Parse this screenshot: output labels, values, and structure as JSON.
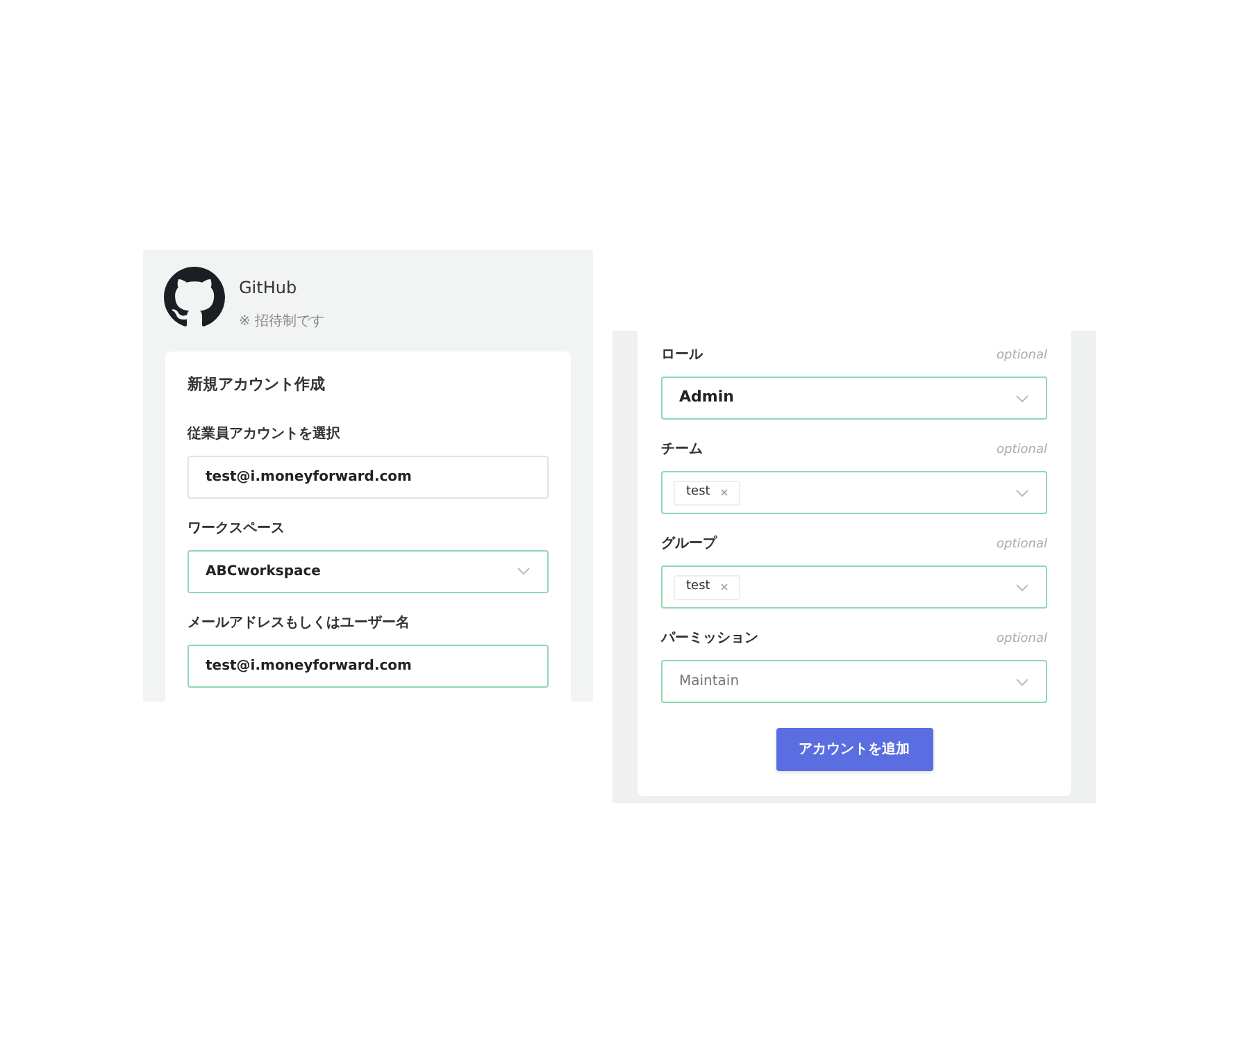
{
  "left_panel": {
    "app": {
      "name": "GitHub",
      "note": "※ 招待制です"
    },
    "card_title": "新規アカウント作成",
    "fields": [
      {
        "label": "従業員アカウントを選択",
        "kind": "input",
        "value": "test@i.moneyforward.com",
        "highlighted": false
      },
      {
        "label": "ワークスペース",
        "kind": "select",
        "value": "ABCworkspace",
        "highlighted": true
      },
      {
        "label": "メールアドレスもしくはユーザー名",
        "kind": "input",
        "value": "test@i.moneyforward.com",
        "highlighted": true
      }
    ]
  },
  "right_panel": {
    "fields": [
      {
        "label": "ロール",
        "hint": "optional",
        "kind": "select",
        "value": "Admin",
        "highlighted": true
      },
      {
        "label": "チーム",
        "hint": "optional",
        "kind": "tags",
        "tags": [
          "test"
        ],
        "highlighted": true
      },
      {
        "label": "グループ",
        "hint": "optional",
        "kind": "tags",
        "tags": [
          "test"
        ],
        "highlighted": true
      },
      {
        "label": "パーミッション",
        "hint": "optional",
        "kind": "select",
        "placeholder": "Maintain",
        "highlighted": true
      }
    ],
    "submit_button": "アカウントを追加"
  }
}
